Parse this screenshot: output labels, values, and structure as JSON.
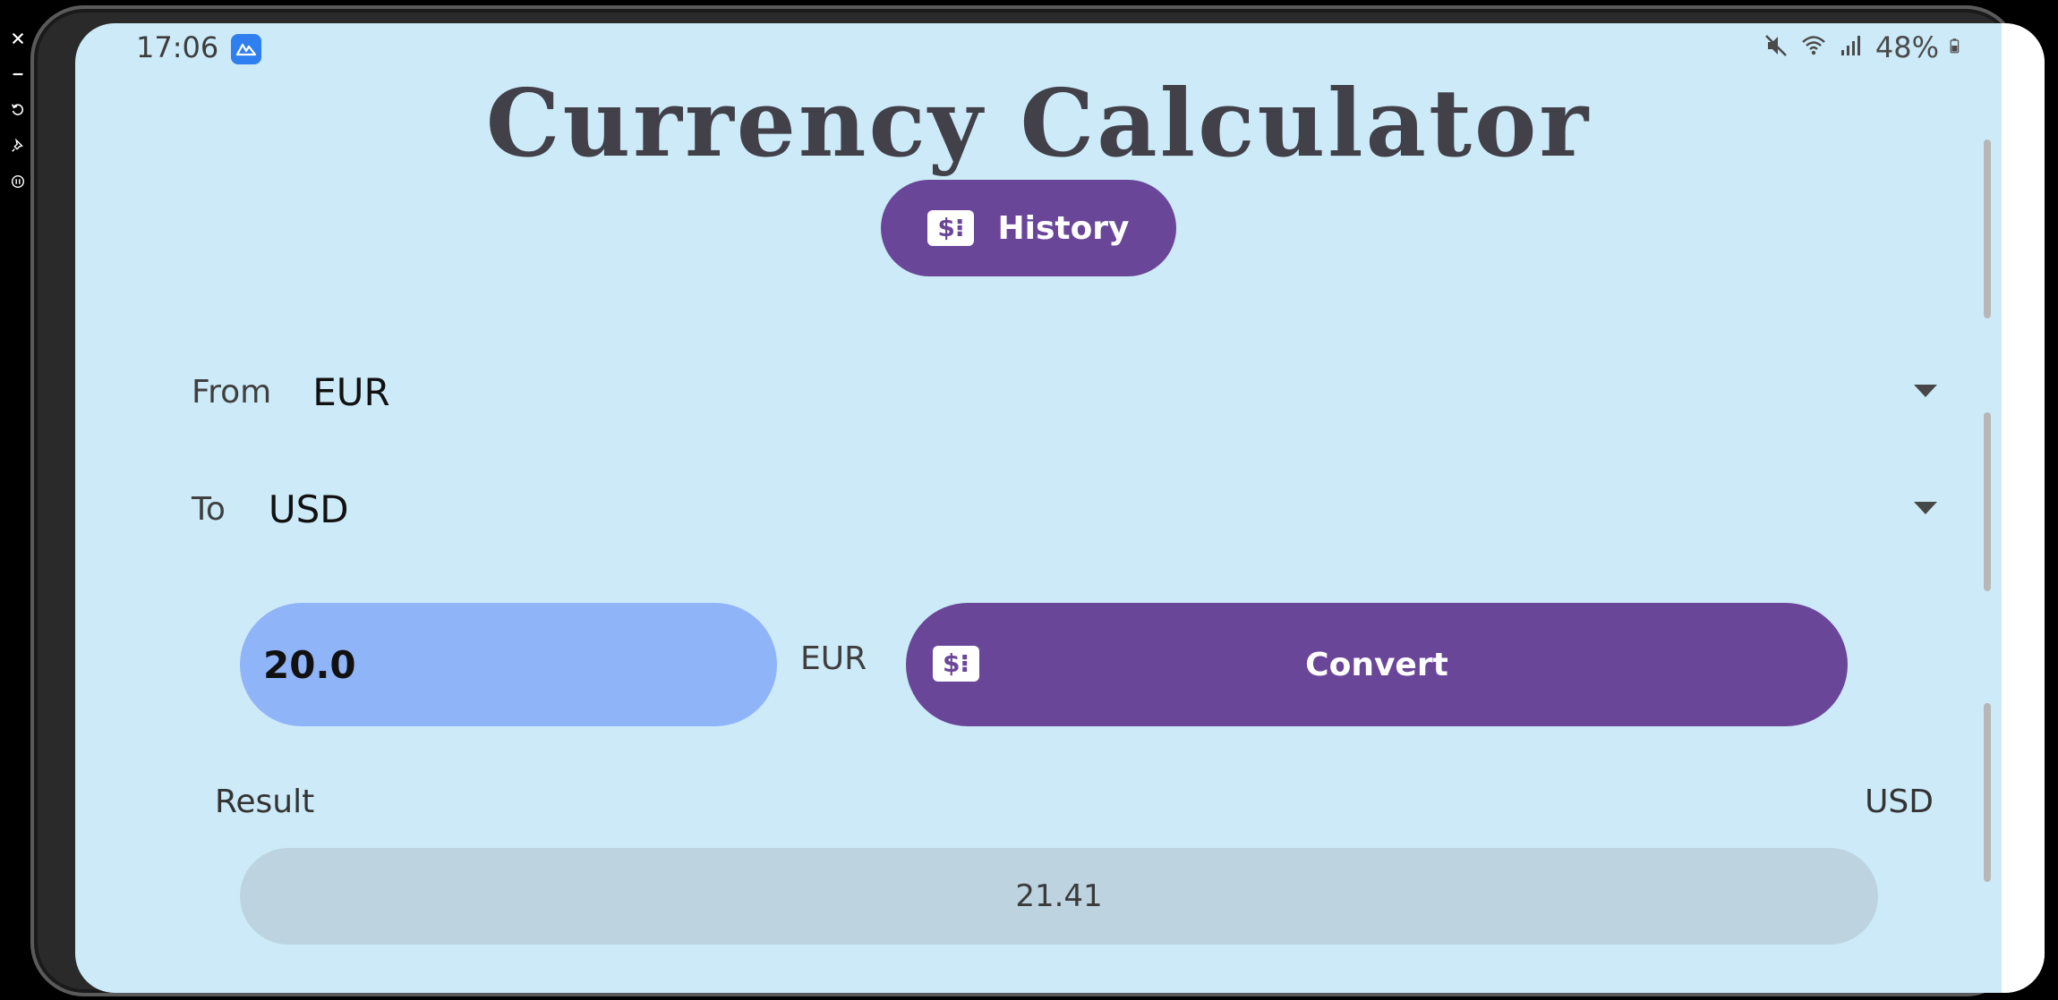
{
  "status_bar": {
    "time": "17:06",
    "app_icon": "mirroring-app-icon",
    "icons": [
      "mute-icon",
      "wifi-icon",
      "signal-icon"
    ],
    "battery_text": "48%",
    "battery_icon": "battery-charging-icon"
  },
  "side_toolbar": {
    "items": [
      "close-icon",
      "minimize-icon",
      "rotate-icon",
      "pin-icon",
      "pause-icon"
    ]
  },
  "app": {
    "title": "Currency Calculator",
    "history_button": {
      "label": "History",
      "icon": "money-exchange-icon"
    },
    "from": {
      "label": "From",
      "value": "EUR"
    },
    "to": {
      "label": "To",
      "value": "USD"
    },
    "amount": {
      "value": "20.0",
      "currency": "EUR"
    },
    "convert_button": {
      "label": "Convert",
      "icon": "money-exchange-icon"
    },
    "result": {
      "label": "Result",
      "currency": "USD",
      "value": "21.41"
    }
  },
  "colors": {
    "background": "#cdeaf8",
    "primary": "#6a4699",
    "input_bg": "#90b4f8",
    "result_bg": "#bdd4e0",
    "title_text": "#424049"
  }
}
